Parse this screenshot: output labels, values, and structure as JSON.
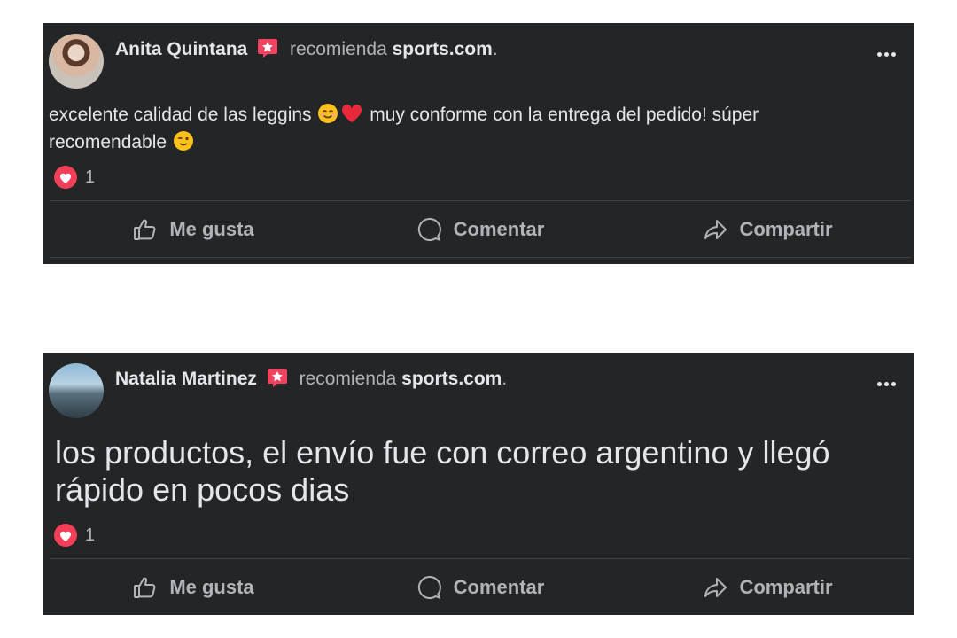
{
  "posts": [
    {
      "author": "Anita Quintana",
      "verb": "recomienda",
      "site": "sports.com",
      "punct": ".",
      "text_before": "excelente calidad de las leggins ",
      "text_after": " muy conforme con la entrega del pedido! súper recomendable ",
      "reaction_count": "1"
    },
    {
      "author": "Natalia Martinez",
      "verb": "recomienda",
      "site": "sports.com",
      "punct": ".",
      "text": "los productos, el envío fue con correo argentino y llegó rápido en pocos dias",
      "reaction_count": "1"
    }
  ],
  "actions": {
    "like": "Me gusta",
    "comment": "Comentar",
    "share": "Compartir"
  },
  "colors": {
    "card_bg": "#242526",
    "primary_text": "#e4e6eb",
    "secondary_text": "#b0b3b8",
    "badge": "#f3425f",
    "reaction": "#f33e58"
  },
  "icons": {
    "recommend": "recommend-badge-icon",
    "more": "more-options-icon",
    "like": "thumbs-up-icon",
    "comment": "comment-bubble-icon",
    "share": "share-arrow-icon",
    "love": "love-reaction-icon"
  }
}
